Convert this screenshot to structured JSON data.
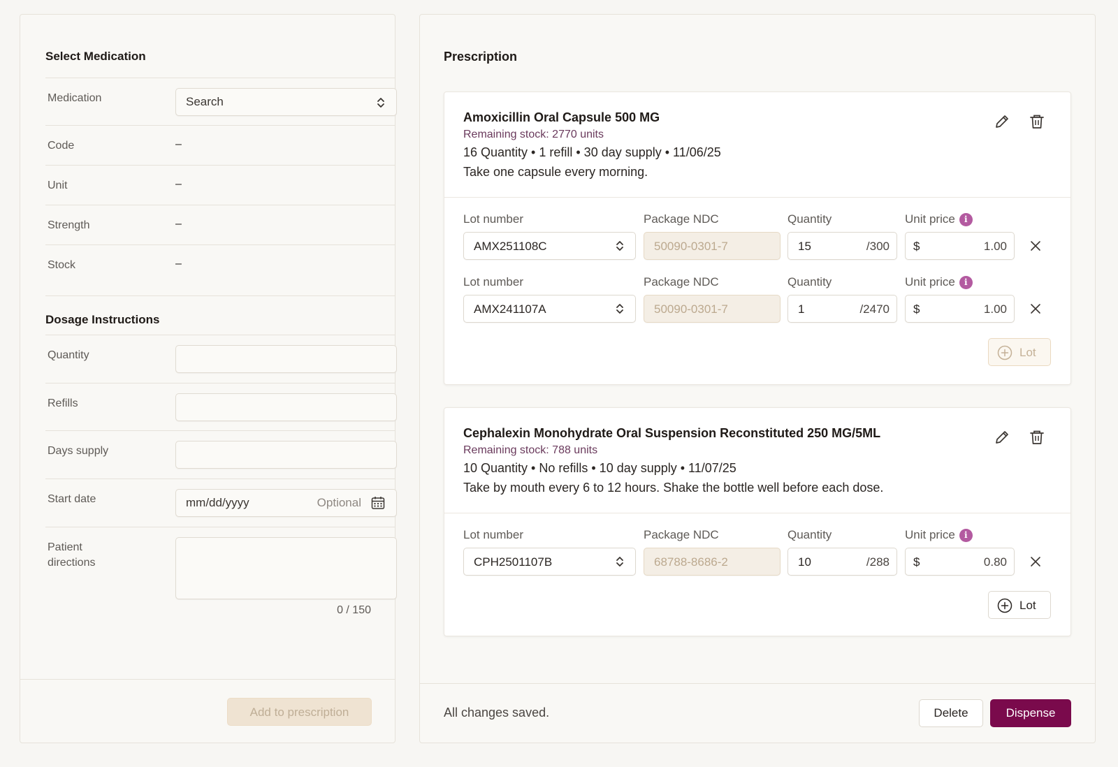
{
  "left": {
    "select_title": "Select Medication",
    "medication_label": "Medication",
    "medication_placeholder": "Search",
    "code_label": "Code",
    "code_value": "–",
    "unit_label": "Unit",
    "unit_value": "–",
    "strength_label": "Strength",
    "strength_value": "–",
    "stock_label": "Stock",
    "stock_value": "–",
    "dosage_title": "Dosage Instructions",
    "quantity_label": "Quantity",
    "refills_label": "Refills",
    "days_supply_label": "Days supply",
    "start_date_label": "Start date",
    "start_date_placeholder": "mm/dd/yyyy",
    "start_date_optional": "Optional",
    "patient_directions_label_1": "Patient",
    "patient_directions_label_2": "directions",
    "counter": "0 / 150",
    "add_button": "Add to prescription"
  },
  "right": {
    "title": "Prescription",
    "saved_status": "All changes saved.",
    "delete_button": "Delete",
    "dispense_button": "Dispense",
    "lot_button": "Lot",
    "field_labels": {
      "lot": "Lot number",
      "ndc": "Package NDC",
      "quantity": "Quantity",
      "unit_price": "Unit price"
    },
    "cards": [
      {
        "title": "Amoxicillin Oral Capsule 500 MG",
        "stock": "Remaining stock: 2770 units",
        "meta": "16 Quantity • 1 refill • 30 day supply • 11/06/25",
        "directions": "Take one capsule every morning.",
        "lots": [
          {
            "lot": "AMX251108C",
            "ndc": "50090-0301-7",
            "qty": "15",
            "max": "/300",
            "currency": "$",
            "price": "1.00"
          },
          {
            "lot": "AMX241107A",
            "ndc": "50090-0301-7",
            "qty": "1",
            "max": "/2470",
            "currency": "$",
            "price": "1.00"
          }
        ]
      },
      {
        "title": "Cephalexin Monohydrate Oral Suspension Reconstituted 250 MG/5ML",
        "stock": "Remaining stock: 788 units",
        "meta": "10 Quantity • No refills • 10 day supply • 11/07/25",
        "directions": "Take by mouth every 6 to 12 hours. Shake the bottle well before each dose.",
        "lots": [
          {
            "lot": "CPH2501107B",
            "ndc": "68788-8686-2",
            "qty": "10",
            "max": "/288",
            "currency": "$",
            "price": "0.80"
          }
        ]
      }
    ]
  },
  "colors": {
    "primary": "#7a0a4c",
    "info": "#b35aa0",
    "stock_text": "#6a3a5c",
    "disabled_bg": "#efe3d2"
  }
}
